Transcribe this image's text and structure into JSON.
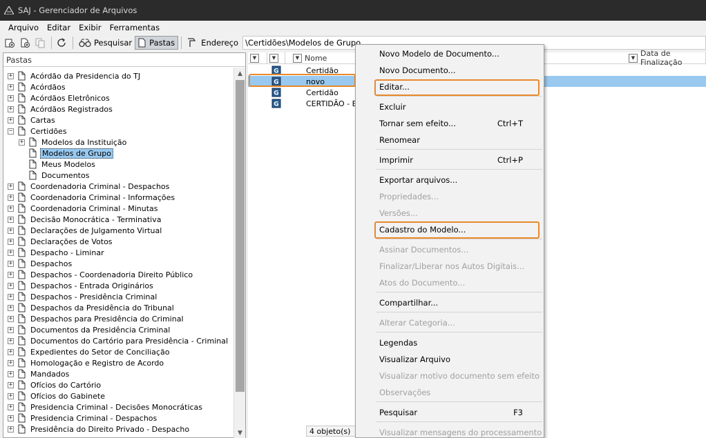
{
  "window": {
    "title": "SAJ - Gerenciador de Arquivos"
  },
  "menubar": {
    "items": [
      {
        "label": "Arquivo",
        "underline": "A"
      },
      {
        "label": "Editar",
        "underline": "E"
      },
      {
        "label": "Exibir",
        "underline": "x"
      },
      {
        "label": "Ferramentas",
        "underline": "F"
      }
    ]
  },
  "toolbar": {
    "pesquisar_label": "Pesquisar",
    "pastas_label": "Pastas",
    "endereco_label": "Endereço",
    "address_value": "\\Certidões\\Modelos de Grupo"
  },
  "left_panel": {
    "header": "Pastas",
    "tree": [
      {
        "label": "Acórdão da Presidencia do TJ",
        "level": 0,
        "expander": "+"
      },
      {
        "label": "Acórdãos",
        "level": 0,
        "expander": "+"
      },
      {
        "label": "Acórdãos Eletrônicos",
        "level": 0,
        "expander": "+"
      },
      {
        "label": "Acórdãos Registrados",
        "level": 0,
        "expander": "+"
      },
      {
        "label": "Cartas",
        "level": 0,
        "expander": "+"
      },
      {
        "label": "Certidões",
        "level": 0,
        "expander": "−"
      },
      {
        "label": "Modelos da Instituição",
        "level": 1,
        "expander": "+"
      },
      {
        "label": "Modelos de Grupo",
        "level": 1,
        "expander": "",
        "selected": true
      },
      {
        "label": "Meus Modelos",
        "level": 1,
        "expander": ""
      },
      {
        "label": "Documentos",
        "level": 1,
        "expander": ""
      },
      {
        "label": "Coordenadoria Criminal - Despachos",
        "level": 0,
        "expander": "+"
      },
      {
        "label": "Coordenadoria Criminal - Informações",
        "level": 0,
        "expander": "+"
      },
      {
        "label": "Coordenadoria Criminal - Minutas",
        "level": 0,
        "expander": "+"
      },
      {
        "label": "Decisão Monocrática - Terminativa",
        "level": 0,
        "expander": "+"
      },
      {
        "label": "Declarações de Julgamento Virtual",
        "level": 0,
        "expander": "+"
      },
      {
        "label": "Declarações de Votos",
        "level": 0,
        "expander": "+"
      },
      {
        "label": "Despacho - Liminar",
        "level": 0,
        "expander": "+"
      },
      {
        "label": "Despachos",
        "level": 0,
        "expander": "+"
      },
      {
        "label": "Despachos - Coordenadoria Direito Público",
        "level": 0,
        "expander": "+"
      },
      {
        "label": "Despachos - Entrada Originários",
        "level": 0,
        "expander": "+"
      },
      {
        "label": "Despachos - Presidência Criminal",
        "level": 0,
        "expander": "+"
      },
      {
        "label": "Despachos da Presidência do Tribunal",
        "level": 0,
        "expander": "+"
      },
      {
        "label": "Despachos para Presidência do Criminal",
        "level": 0,
        "expander": "+"
      },
      {
        "label": "Documentos da Presidência Criminal",
        "level": 0,
        "expander": "+"
      },
      {
        "label": "Documentos do Cartório para Presidência - Criminal",
        "level": 0,
        "expander": "+"
      },
      {
        "label": "Expedientes do Setor de Conciliação",
        "level": 0,
        "expander": "+"
      },
      {
        "label": "Homologação e Registro de Acordo",
        "level": 0,
        "expander": "+"
      },
      {
        "label": "Mandados",
        "level": 0,
        "expander": "+"
      },
      {
        "label": "Ofícios do Cartório",
        "level": 0,
        "expander": "+"
      },
      {
        "label": "Ofícios do Gabinete",
        "level": 0,
        "expander": "+"
      },
      {
        "label": "Presidencia Criminal - Decisões Monocráticas",
        "level": 0,
        "expander": "+"
      },
      {
        "label": "Presidencia Criminal - Despachos",
        "level": 0,
        "expander": "+"
      },
      {
        "label": "Presidência do Direito Privado - Despacho",
        "level": 0,
        "expander": "+"
      }
    ]
  },
  "file_list": {
    "columns": {
      "name": "Nome",
      "date": "Data de Finalização"
    },
    "rows": [
      {
        "name": "Certidão",
        "selected": false
      },
      {
        "name": "novo",
        "selected": true
      },
      {
        "name": "Certidão",
        "selected": false
      },
      {
        "name": "CERTIDÃO - EM",
        "selected": false
      }
    ],
    "status": "4 objeto(s)"
  },
  "context_menu": {
    "items": [
      {
        "label": "Novo Modelo de Documento...",
        "enabled": true,
        "shortcut": ""
      },
      {
        "label": "Novo Documento...",
        "enabled": true,
        "shortcut": ""
      },
      {
        "label": "Editar...",
        "enabled": true,
        "shortcut": "",
        "highlighted": true
      },
      {
        "label": "Excluir",
        "enabled": true,
        "shortcut": ""
      },
      {
        "label": "Tornar sem efeito...",
        "enabled": true,
        "shortcut": "Ctrl+T"
      },
      {
        "label": "Renomear",
        "enabled": true,
        "shortcut": ""
      },
      {
        "label": "Imprimir",
        "enabled": true,
        "shortcut": "Ctrl+P"
      },
      {
        "label": "Exportar arquivos...",
        "enabled": true,
        "shortcut": ""
      },
      {
        "label": "Propriedades...",
        "enabled": false,
        "shortcut": ""
      },
      {
        "label": "Versões...",
        "enabled": false,
        "shortcut": ""
      },
      {
        "label": "Cadastro do Modelo...",
        "enabled": true,
        "shortcut": "",
        "highlighted": true
      },
      {
        "label": "Assinar Documentos...",
        "enabled": false,
        "shortcut": ""
      },
      {
        "label": "Finalizar/Liberar nos Autos Digitais...",
        "enabled": false,
        "shortcut": ""
      },
      {
        "label": "Atos do Documento...",
        "enabled": false,
        "shortcut": ""
      },
      {
        "label": "Compartilhar...",
        "enabled": true,
        "shortcut": ""
      },
      {
        "label": "Alterar Categoria...",
        "enabled": false,
        "shortcut": ""
      },
      {
        "label": "Legendas",
        "enabled": true,
        "shortcut": ""
      },
      {
        "label": "Visualizar Arquivo",
        "enabled": true,
        "shortcut": ""
      },
      {
        "label": "Visualizar motivo documento sem efeito",
        "enabled": false,
        "shortcut": ""
      },
      {
        "label": "Observações",
        "enabled": false,
        "shortcut": ""
      },
      {
        "label": "Pesquisar",
        "enabled": true,
        "shortcut": "F3"
      },
      {
        "label": "Visualizar mensagens do processamento",
        "enabled": false,
        "shortcut": ""
      }
    ]
  },
  "colors": {
    "selection": "#99c9ef",
    "highlight_border": "#e8892b",
    "titlebar": "#2b2b2b"
  }
}
